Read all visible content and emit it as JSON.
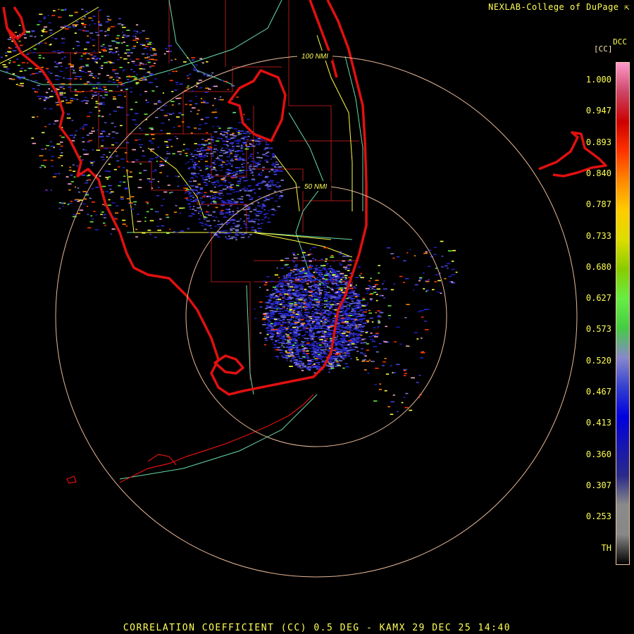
{
  "header": {
    "credit": "NEXLAB-College of DuPage"
  },
  "footer": {
    "title": "CORRELATION COEFFICIENT (CC) 0.5 DEG - KAMX 29 DEC 25 14:40"
  },
  "radar": {
    "ring_labels": [
      "100 NMI",
      "50 NMI"
    ],
    "colors": {
      "coast": "#e01010",
      "state": "#aa1818",
      "county": "#bb2020",
      "roads": "#ffff44",
      "highways": "#66ddaa",
      "ring": "#e8b898"
    }
  },
  "legend": {
    "product": "DCC",
    "units": "[CC]",
    "ticks": [
      "1.000",
      "0.947",
      "0.893",
      "0.840",
      "0.787",
      "0.733",
      "0.680",
      "0.627",
      "0.573",
      "0.520",
      "0.467",
      "0.413",
      "0.360",
      "0.307",
      "0.253",
      "TH"
    ],
    "color_stops": [
      "#000000",
      "#888888",
      "#8a8a8a",
      "#2a2a8a",
      "#1616b0",
      "#0000e0",
      "#3340d0",
      "#8888cc",
      "#44cc44",
      "#66ee44",
      "#88cc00",
      "#dddd00",
      "#ffcc00",
      "#ff8800",
      "#ff3300",
      "#cc0000",
      "#cc4466",
      "#ff99cc"
    ]
  }
}
